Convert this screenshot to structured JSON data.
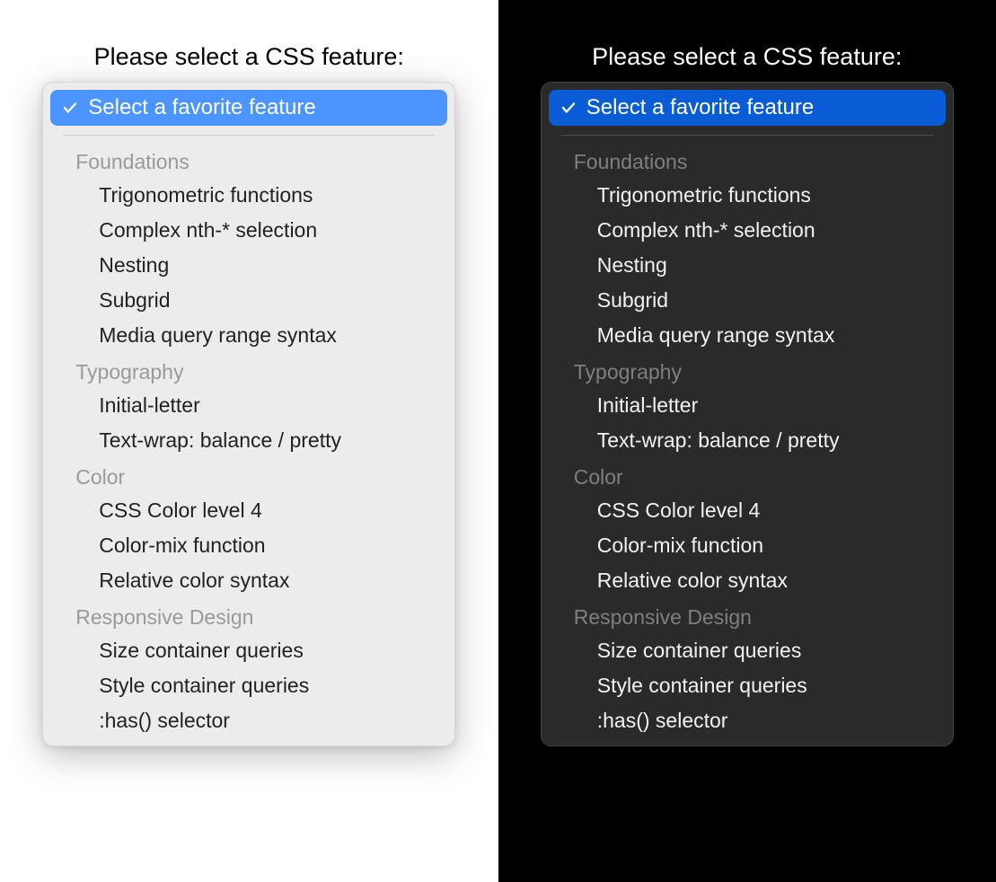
{
  "panes": {
    "light": {
      "prompt": "Please select a CSS feature:",
      "selected": "Select a favorite feature",
      "colors": {
        "highlight": "#4c94ff",
        "background": "#ffffff",
        "panel": "#ececec"
      }
    },
    "dark": {
      "prompt": "Please select a CSS feature:",
      "selected": "Select a favorite feature",
      "colors": {
        "highlight": "#0a5cd6",
        "background": "#000000",
        "panel": "#2a2a2a"
      }
    }
  },
  "icon": {
    "check": "checkmark-icon"
  },
  "groups": [
    {
      "label": "Foundations",
      "options": [
        "Trigonometric functions",
        "Complex nth-* selection",
        "Nesting",
        "Subgrid",
        "Media query range syntax"
      ]
    },
    {
      "label": "Typography",
      "options": [
        "Initial-letter",
        "Text-wrap: balance / pretty"
      ]
    },
    {
      "label": "Color",
      "options": [
        "CSS Color level 4",
        "Color-mix function",
        "Relative color syntax"
      ]
    },
    {
      "label": "Responsive Design",
      "options": [
        "Size container queries",
        "Style container queries",
        ":has() selector"
      ]
    }
  ]
}
